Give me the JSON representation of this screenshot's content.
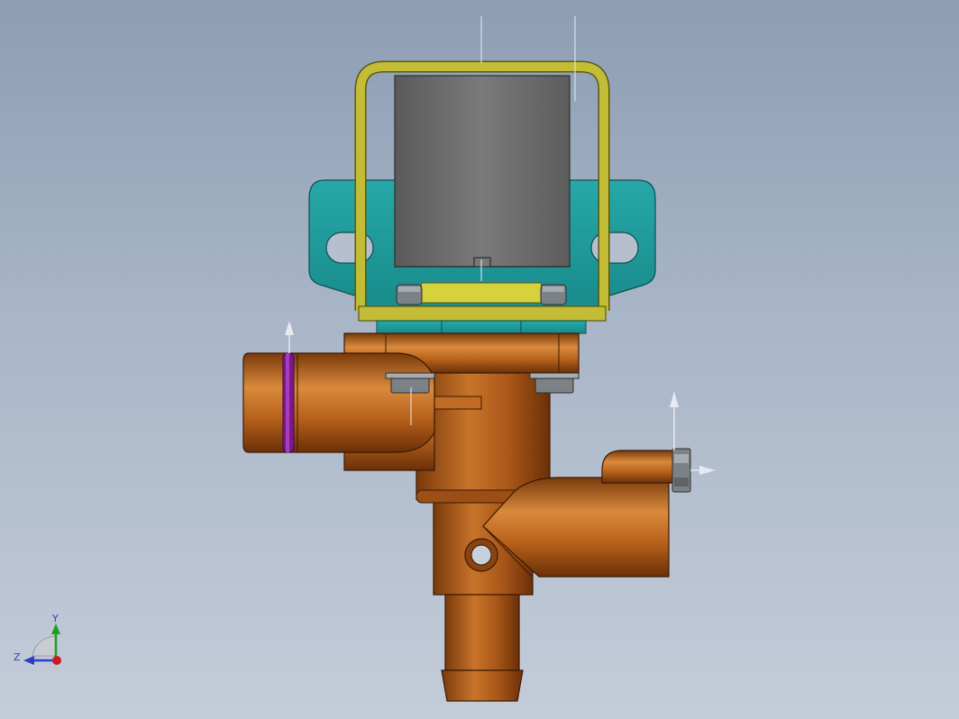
{
  "viewport": {
    "background_top": "#8d9db3",
    "background_bottom": "#c4ccd9"
  },
  "colors": {
    "coil": "#6e6e6e",
    "bracket": "#b8b22e",
    "mount_plate": "#1f9a9a",
    "valve_body": "#b8621c",
    "o_ring": "#7a1a8a",
    "nut": "#8a8f94"
  },
  "triad": {
    "y_label": "Y",
    "z_label": "Z",
    "x_color": "#c81e1e",
    "y_color": "#1ea01e",
    "z_color": "#2a3cc8"
  }
}
